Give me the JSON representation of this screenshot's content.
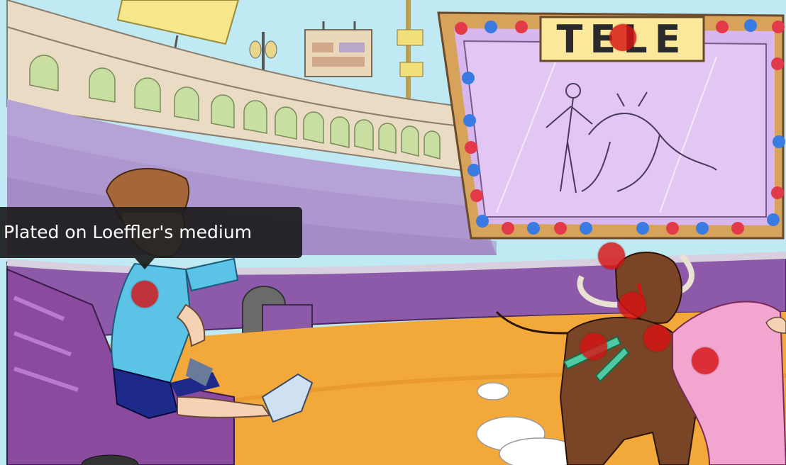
{
  "tooltip": {
    "text": "Plated on Loeffler's medium"
  },
  "screen": {
    "sign": "TELE"
  },
  "hotspots": [
    "tele-sign-marker",
    "child-arm-marker",
    "bull-head-marker",
    "bull-nose-marker",
    "bull-neck-marker",
    "syringe-marker",
    "bull-chest-marker",
    "cape-marker"
  ],
  "colors": {
    "sky": "#bfe9f3",
    "stands": "#b6a3d6",
    "arena_sand": "#f2a93a",
    "barrier": "#8c5aa8",
    "screen_frame": "#d7a35a",
    "screen_glass": "#d8b6ee",
    "hotspot": "#d61414",
    "bull": "#7a4426",
    "cape": "#f2a6cf",
    "shirt": "#5bc3e6"
  }
}
